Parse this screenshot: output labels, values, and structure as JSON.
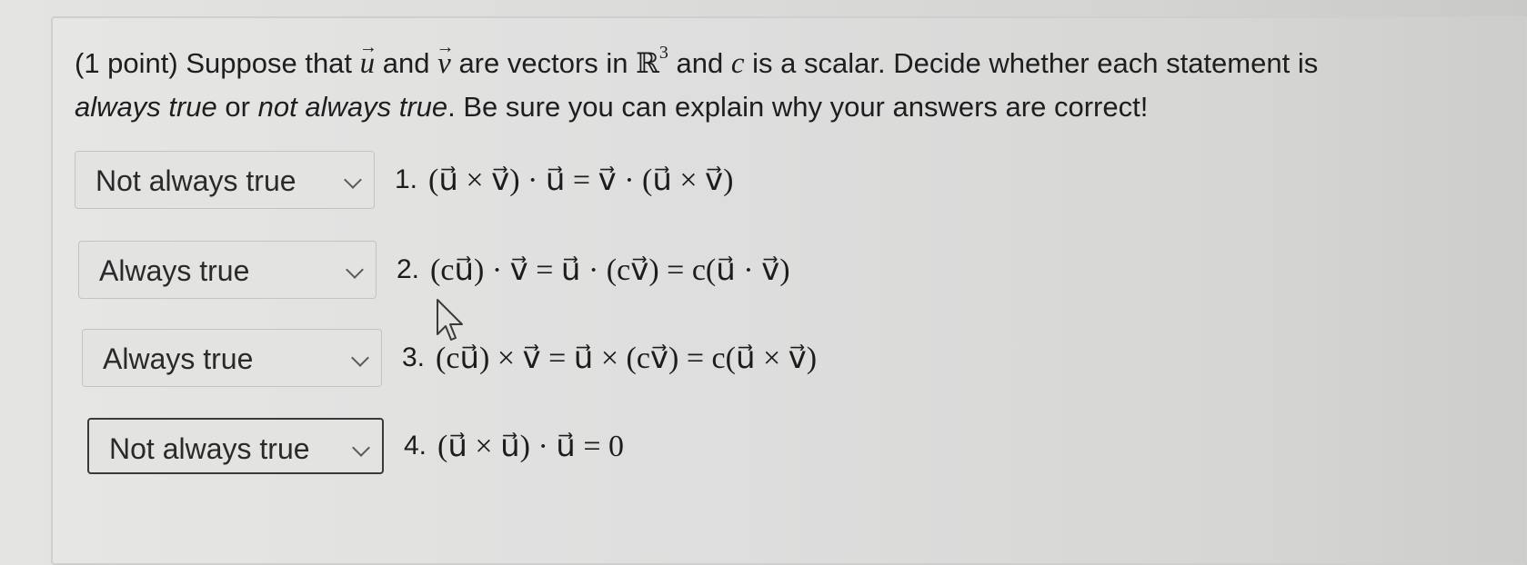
{
  "question": {
    "prefix": "(1 point) Suppose that",
    "vec_u": "u",
    "and1": "and",
    "vec_v": "v",
    "are_vectors_in": "are vectors in",
    "space": "ℝ",
    "space_power": "3",
    "and2": "and",
    "scalar_c": "c",
    "is_scalar": "is a scalar. Decide whether each statement is",
    "option_true": "always true",
    "or": "or",
    "option_false": "not always true",
    "suffix": ". Be sure you can explain why your answers are correct!"
  },
  "statements": [
    {
      "selected": "Not always true",
      "number": "1.",
      "expression": "(u⃗ × v⃗) · u⃗ = v⃗ · (u⃗ × v⃗)"
    },
    {
      "selected": "Always true",
      "number": "2.",
      "expression": "(cu⃗) · v⃗ = u⃗ · (cv⃗) = c(u⃗ · v⃗)"
    },
    {
      "selected": "Always true",
      "number": "3.",
      "expression": "(cu⃗) × v⃗ = u⃗ × (cv⃗) = c(u⃗ × v⃗)"
    },
    {
      "selected": "Not always true",
      "number": "4.",
      "expression": "(u⃗ × u⃗) · u⃗ = 0"
    }
  ],
  "select_options": [
    "Not always true",
    "Always true"
  ],
  "colors": {
    "background": "#dcdcda",
    "text": "#1e1e1e",
    "select_border": "#c3c3c1",
    "focused_border": "#3a3a3a"
  },
  "icons": {
    "dropdown": "chevron-down-icon",
    "pointer": "mouse-cursor-icon"
  }
}
